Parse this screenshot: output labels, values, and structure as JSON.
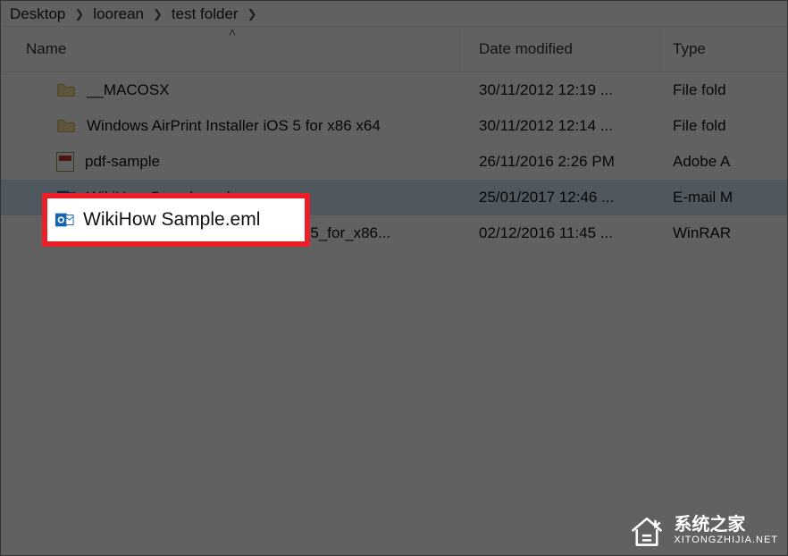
{
  "breadcrumb": {
    "items": [
      "Desktop",
      "loorean",
      "test folder"
    ]
  },
  "columns": {
    "name": "Name",
    "date": "Date modified",
    "type": "Type"
  },
  "rows": [
    {
      "icon": "folder",
      "name": "__MACOSX",
      "date": "30/11/2012 12:19 ...",
      "type": "File fold"
    },
    {
      "icon": "folder",
      "name": "Windows AirPrint Installer iOS 5 for x86 x64",
      "date": "30/11/2012 12:14 ...",
      "type": "File fold"
    },
    {
      "icon": "pdf",
      "name": "pdf-sample",
      "date": "26/11/2016 2:26 PM",
      "type": "Adobe A"
    },
    {
      "icon": "outlook",
      "name": "WikiHow Sample.eml",
      "date": "25/01/2017 12:46 ...",
      "type": "E-mail M",
      "selected": true,
      "highlighted": true
    },
    {
      "icon": "rar",
      "name": "Windows_AirPrint_Installer_iOS_5_for_x86...",
      "date": "02/12/2016 11:45 ...",
      "type": "WinRAR"
    }
  ],
  "highlight_label": "WikiHow Sample.eml",
  "watermark": {
    "title": "系统之家",
    "url": "XITONGZHIJIA.NET"
  }
}
